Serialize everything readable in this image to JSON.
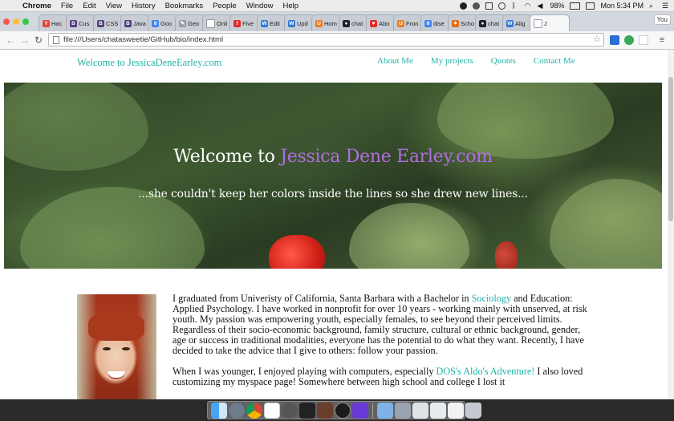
{
  "menubar": {
    "app": "Chrome",
    "items": [
      "File",
      "Edit",
      "View",
      "History",
      "Bookmarks",
      "People",
      "Window",
      "Help"
    ],
    "battery": "98%",
    "clock": "Mon 5:34 PM"
  },
  "tabs": [
    {
      "label": "Hac",
      "color": "#e8433a",
      "glyph": "Y"
    },
    {
      "label": "Cus",
      "color": "#563d7c",
      "glyph": "B"
    },
    {
      "label": "CSS",
      "color": "#563d7c",
      "glyph": "B"
    },
    {
      "label": "Java",
      "color": "#563d7c",
      "glyph": "B"
    },
    {
      "label": "Goo",
      "color": "#4285f4",
      "glyph": "8"
    },
    {
      "label": "Geo",
      "color": "#9e9e9e",
      "glyph": "✎"
    },
    {
      "label": "Onli",
      "color": "#ffffff",
      "glyph": ""
    },
    {
      "label": "Five",
      "color": "#e02a2a",
      "glyph": "f"
    },
    {
      "label": "Edit",
      "color": "#2d7bd6",
      "glyph": "W"
    },
    {
      "label": "Upd",
      "color": "#2d7bd6",
      "glyph": "W"
    },
    {
      "label": "Hom",
      "color": "#f07c1e",
      "glyph": "U"
    },
    {
      "label": "chat",
      "color": "#222222",
      "glyph": "●"
    },
    {
      "label": "Abo",
      "color": "#d93025",
      "glyph": "♥"
    },
    {
      "label": "Fron",
      "color": "#f07c1e",
      "glyph": "U"
    },
    {
      "label": "dise",
      "color": "#4285f4",
      "glyph": "8"
    },
    {
      "label": "Scho",
      "color": "#e26a1b",
      "glyph": "✶"
    },
    {
      "label": "chat",
      "color": "#222222",
      "glyph": "●"
    },
    {
      "label": "Alig",
      "color": "#2d7bd6",
      "glyph": "W"
    },
    {
      "label": "J",
      "color": "#ffffff",
      "glyph": "",
      "active": true
    }
  ],
  "profile": "You",
  "address": {
    "url": "file:///Users/chatasweetie/GitHub/bio/index.html"
  },
  "site": {
    "brand": "Welcome to JessicaDeneEarley.com",
    "nav": [
      "About Me",
      "My projects",
      "Quotes",
      "Contact Me"
    ],
    "hero_title_prefix": "Welcome to ",
    "hero_title_accent": "Jessica Dene Earley.com",
    "hero_tagline": "...she couldn't keep her colors inside the lines so she drew new lines...",
    "bio_p1_a": "I graduated from Univeristy of California, Santa Barbara with a Bachelor in ",
    "bio_p1_link": "Sociology",
    "bio_p1_b": " and Education: Applied Psychology. I have worked in nonprofit for over 10 years - working mainly with unserved, at risk youth. My passion was empowering youth, especially females, to see beyond their perceived limits. Regardless of their socio-economic background, family structure, cultural or ethnic background, gender, age or success in traditional modalities, everyone has the potential to do what they want. Recently, I have decided to take the advice that I give to others: follow your passion.",
    "bio_p2_a": "When I was younger, I enjoyed playing with computers, especially ",
    "bio_p2_link": "DOS's Aldo's Adventure!",
    "bio_p2_b": " I also loved customizing my myspace page! Somewhere between high school and college I lost it"
  },
  "colors": {
    "link": "#20b2a6",
    "accent": "#b06ee0"
  }
}
